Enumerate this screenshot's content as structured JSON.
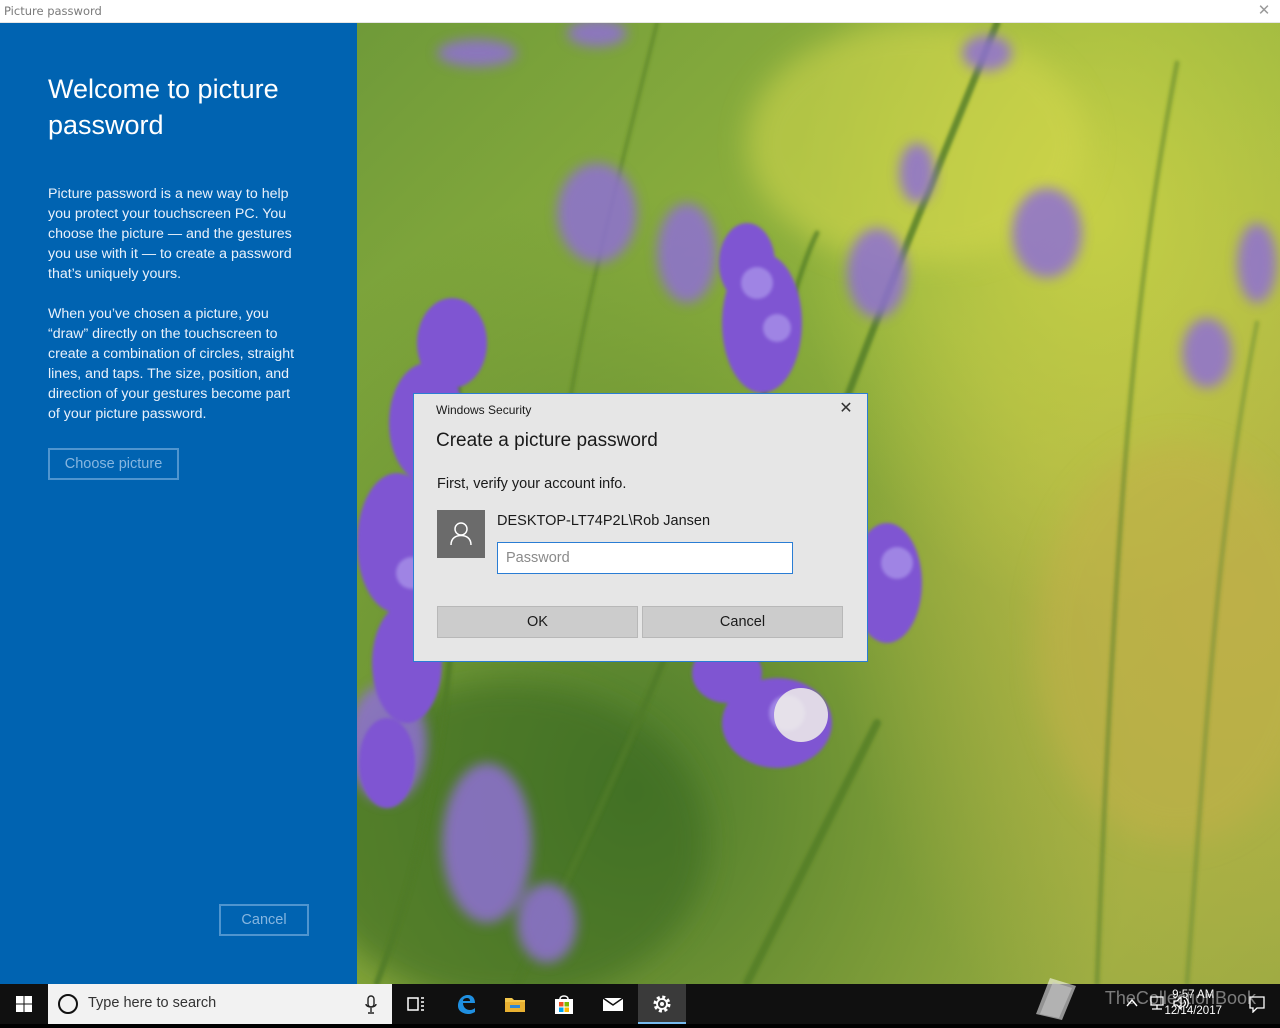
{
  "window": {
    "title": "Picture password"
  },
  "left_panel": {
    "heading": "Welcome to picture password",
    "paragraph1": "Picture password is a new way to help you protect your touchscreen PC. You choose the picture — and the gestures you use with it — to create a password that’s uniquely yours.",
    "paragraph2": "When you’ve chosen a picture, you “draw” directly on the touchscreen to create a combination of circles, straight lines, and taps. The size, position, and direction of your gestures become part of your picture password.",
    "choose_button": "Choose picture",
    "cancel_button": "Cancel"
  },
  "dialog": {
    "title": "Windows Security",
    "heading": "Create a picture password",
    "instruction": "First, verify your account info.",
    "account": "DESKTOP-LT74P2L\\Rob Jansen",
    "password_placeholder": "Password",
    "password_value": "",
    "ok_button": "OK",
    "cancel_button": "Cancel"
  },
  "taskbar": {
    "search_placeholder": "Type here to search",
    "time": "9:57 AM",
    "date": "12/14/2017",
    "watermark": "TheCollectionBook"
  },
  "colors": {
    "panel_blue": "#0063b1",
    "dialog_border": "#2a7dd4",
    "taskbar": "#101010"
  },
  "icons": [
    "close-icon",
    "user-icon",
    "windows-logo-icon",
    "cortana-icon",
    "microphone-icon",
    "task-view-icon",
    "edge-icon",
    "file-explorer-icon",
    "store-icon",
    "mail-icon",
    "settings-gear-icon",
    "chevron-up-icon",
    "network-icon",
    "volume-icon",
    "notification-icon"
  ]
}
